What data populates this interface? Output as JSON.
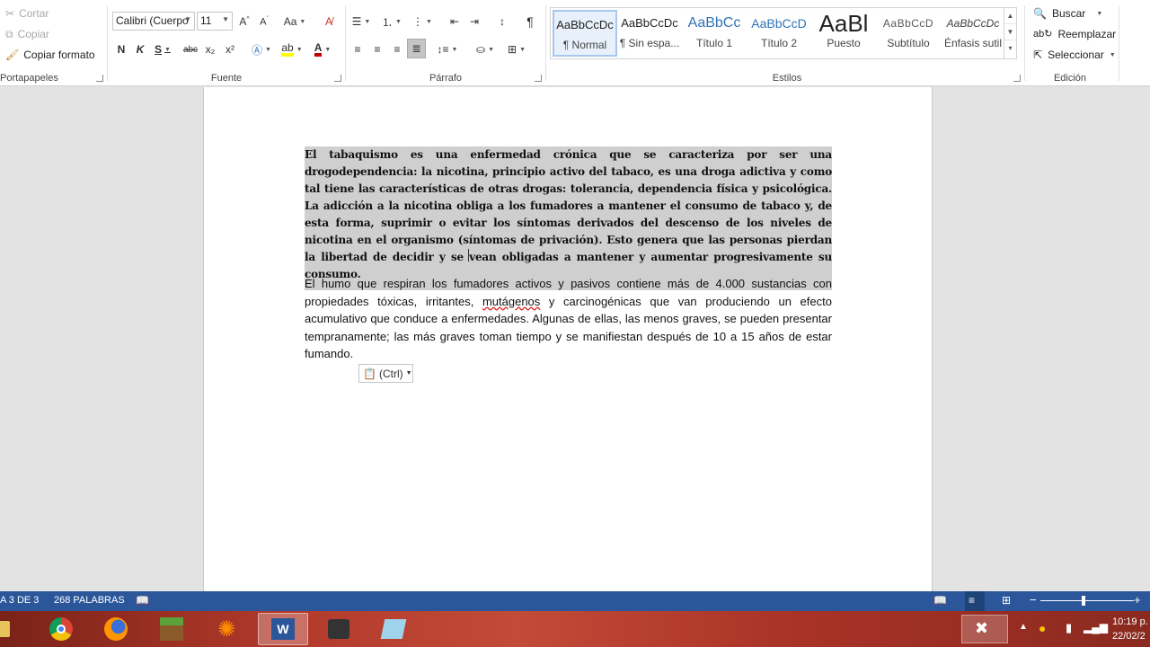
{
  "ribbon": {
    "clipboard": {
      "cut": "Cortar",
      "copy": "Copiar",
      "format_painter": "Copiar formato",
      "group_label": "Portapapeles"
    },
    "font": {
      "font_name": "Calibri (Cuerpo",
      "font_size": "11",
      "case_label": "Aa",
      "bold": "N",
      "italic": "K",
      "underline": "S",
      "strike": "abc",
      "subscript": "x₂",
      "superscript": "x²",
      "group_label": "Fuente"
    },
    "paragraph": {
      "group_label": "Párrafo",
      "pilcrow": "¶"
    },
    "styles": {
      "group_label": "Estilos",
      "items": [
        {
          "sample": "AaBbCcDc",
          "name": "¶ Normal"
        },
        {
          "sample": "AaBbCcDc",
          "name": "¶ Sin espa..."
        },
        {
          "sample": "AaBbCc",
          "name": "Título 1"
        },
        {
          "sample": "AaBbCcD",
          "name": "Título 2"
        },
        {
          "sample": "AaBl",
          "name": "Puesto"
        },
        {
          "sample": "AaBbCcD",
          "name": "Subtítulo"
        },
        {
          "sample": "AaBbCcDc",
          "name": "Énfasis sutil"
        }
      ]
    },
    "editing": {
      "find": "Buscar",
      "replace": "Reemplazar",
      "select": "Seleccionar",
      "group_label": "Edición"
    }
  },
  "document": {
    "paragraph1": "El tabaquismo es una enfermedad crónica que se caracteriza por ser una drogodependencia: la nicotina, principio activo del tabaco, es una droga adictiva y como tal tiene las características de otras drogas: tolerancia, dependencia física y psicológica. La adicción a la nicotina obliga a los fumadores a mantener el consumo de tabaco y, de esta forma, suprimir o evitar los síntomas derivados del descenso de los niveles de nicotina en el organismo (síntomas de privación). Esto genera que las personas pierdan la libertad de decidir y se vean obligadas a mantener y aumentar progresivamente su consumo.",
    "paragraph2_before": "El humo que respiran los fumadores activos y pasivos contiene más de 4.000 sustancias con propiedades tóxicas, irritantes, ",
    "paragraph2_misspelled": "mutágenos",
    "paragraph2_after": " y carcinogénicas que van produciendo un efecto acumulativo que conduce a enfermedades. Algunas de ellas, las menos graves, se pueden presentar tempranamente; las más graves toman tiempo y se manifiestan después de 10 a 15 años de estar fumando.",
    "paste_options": "(Ctrl)"
  },
  "status_bar": {
    "page": "A 3 DE 3",
    "words": "268 PALABRAS"
  },
  "taskbar": {
    "time": "10:19 p.",
    "date": "22/02/2"
  },
  "colors": {
    "status_bar": "#2b579a",
    "selection": "#cfcfcf",
    "ribbon_bg": "#ffffff",
    "canvas_bg": "#e3e3e3"
  }
}
